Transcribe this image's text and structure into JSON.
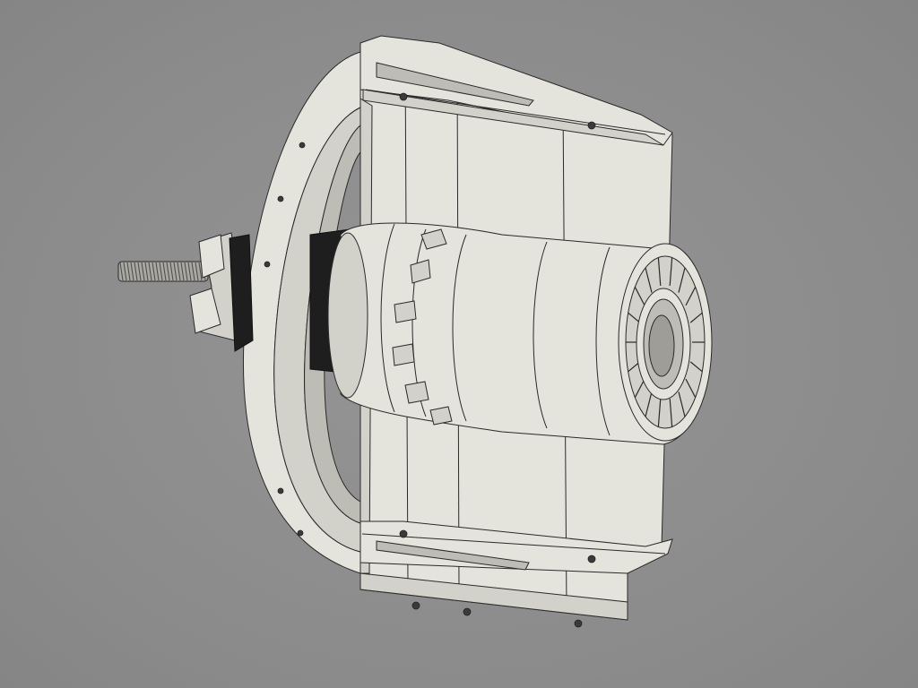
{
  "viewport": {
    "background_color": "#8e8e8e",
    "model_color": "#e4e3dc",
    "edge_color": "#2a2a2a"
  },
  "model": {
    "parts": [
      "mounting-plate",
      "curved-guard-ring",
      "engine-body",
      "exhaust-nozzle",
      "threaded-rod",
      "clamp-bracket",
      "retaining-clips"
    ]
  }
}
